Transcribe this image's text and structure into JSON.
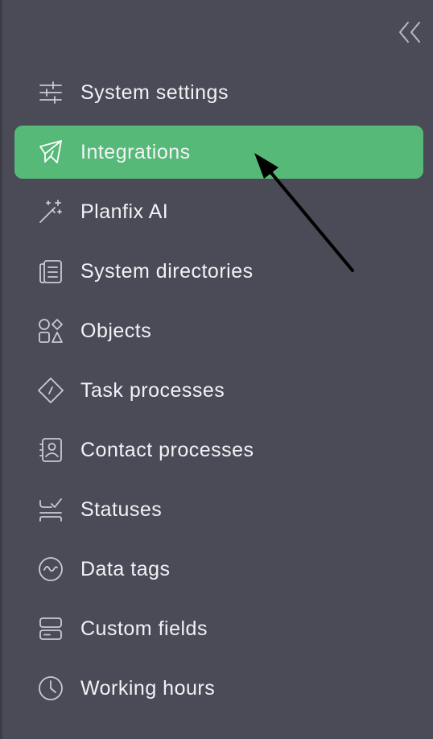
{
  "sidebar": {
    "collapse_icon": "double-chevron-left-icon",
    "items": [
      {
        "label": "System settings",
        "icon": "sliders-icon",
        "active": false
      },
      {
        "label": "Integrations",
        "icon": "paper-plane-icon",
        "active": true
      },
      {
        "label": "Planfix AI",
        "icon": "magic-wand-icon",
        "active": false
      },
      {
        "label": "System directories",
        "icon": "directory-book-icon",
        "active": false
      },
      {
        "label": "Objects",
        "icon": "shapes-icon",
        "active": false
      },
      {
        "label": "Task processes",
        "icon": "diamond-process-icon",
        "active": false
      },
      {
        "label": "Contact processes",
        "icon": "contact-card-icon",
        "active": false
      },
      {
        "label": "Statuses",
        "icon": "status-check-icon",
        "active": false
      },
      {
        "label": "Data tags",
        "icon": "wave-circle-icon",
        "active": false
      },
      {
        "label": "Custom fields",
        "icon": "fields-stack-icon",
        "active": false
      },
      {
        "label": "Working hours",
        "icon": "clock-icon",
        "active": false
      }
    ]
  },
  "colors": {
    "background": "#4a4b57",
    "active_item": "#57b978",
    "text": "#f2f2f5",
    "icon": "#c9cad2"
  }
}
